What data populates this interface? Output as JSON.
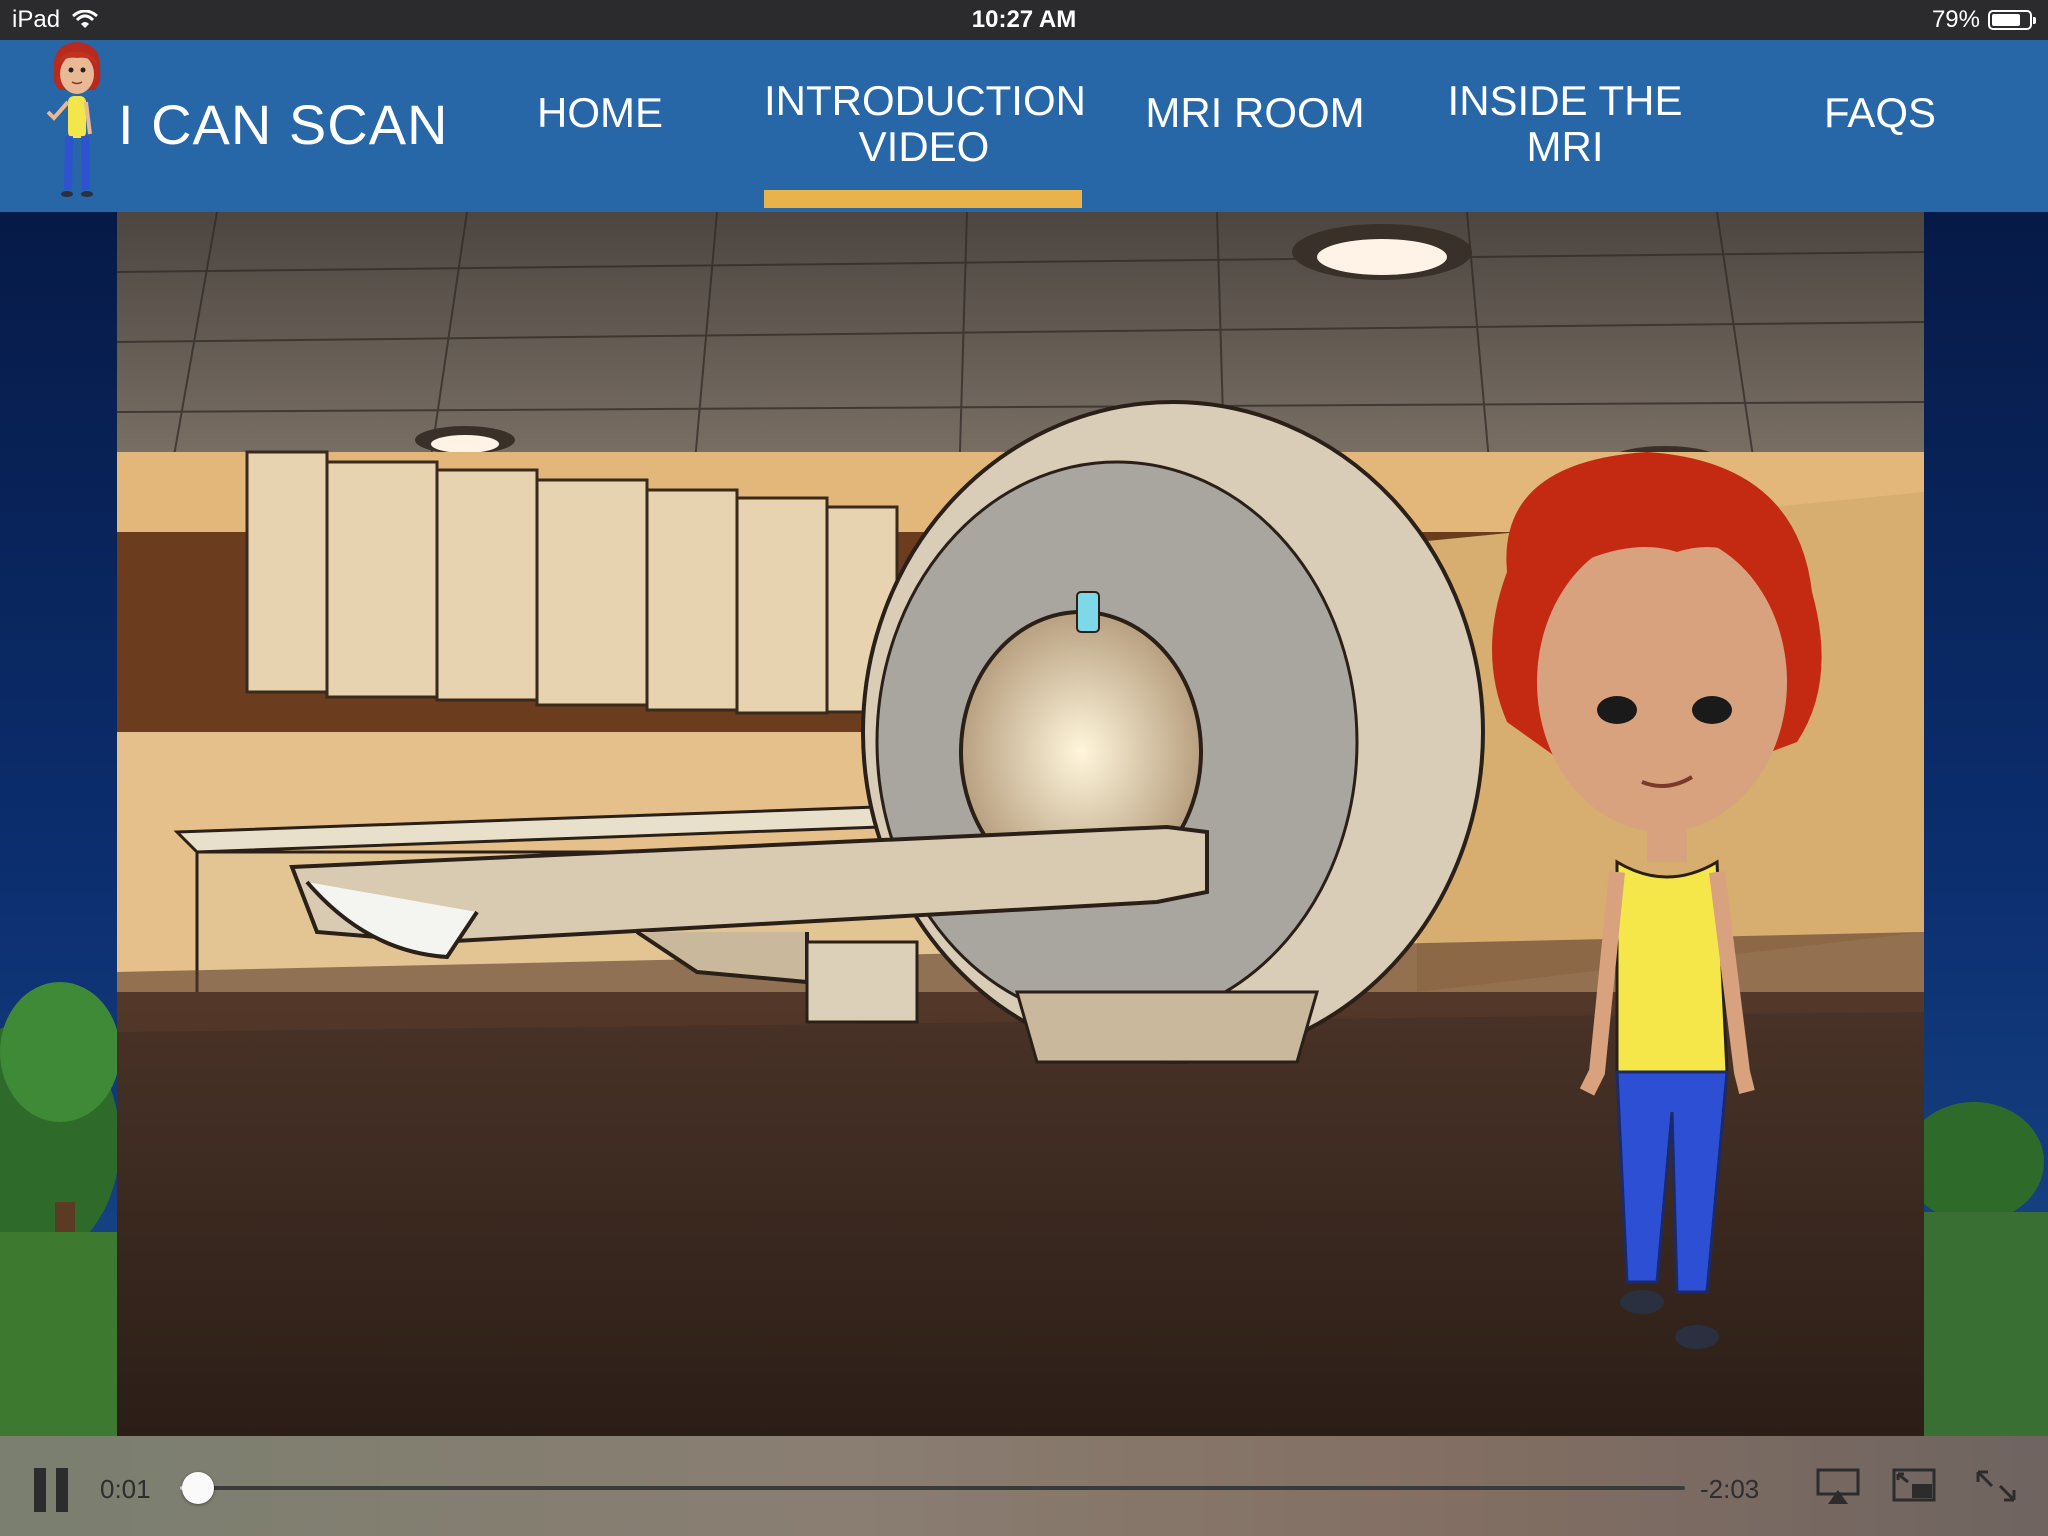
{
  "status_bar": {
    "device": "iPad",
    "time": "10:27 AM",
    "battery": "79%",
    "battery_level": 0.79
  },
  "nav": {
    "brand": "I CAN SCAN",
    "items": [
      {
        "label": "HOME",
        "active": false
      },
      {
        "label": "INTRODUCTION VIDEO",
        "line1": "INTRODUCTION",
        "line2": "VIDEO",
        "active": true
      },
      {
        "label": "MRI ROOM",
        "active": false
      },
      {
        "label": "INSIDE THE MRI",
        "line1": "INSIDE THE",
        "line2": "MRI",
        "active": false
      },
      {
        "label": "FAQS",
        "active": false
      }
    ],
    "active_color": "#e9b24a",
    "bar_color": "#2766a7"
  },
  "video": {
    "scene": "mri-room-with-cartoon-girl",
    "current_time": "0:01",
    "remaining_time": "-2:03",
    "progress": 0.008,
    "controls": [
      "pause-icon",
      "airplay-icon",
      "picture-in-picture-icon",
      "fullscreen-icon"
    ]
  }
}
